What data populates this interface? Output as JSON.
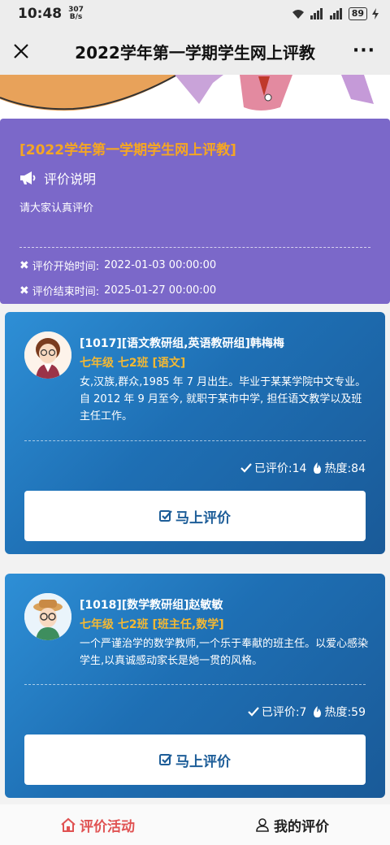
{
  "status_bar": {
    "time": "10:48",
    "speed_value": "307",
    "speed_unit": "B/s",
    "battery": "89"
  },
  "nav": {
    "title": "2022学年第一学期学生网上评教"
  },
  "info": {
    "title": "[2022学年第一学期学生网上评教]",
    "heading": "评价说明",
    "description": "请大家认真评价",
    "start_label": "评价开始时间:",
    "start_time": "2022-01-03 00:00:00",
    "end_label": "评价结束时间:",
    "end_time": "2025-01-27 00:00:00"
  },
  "teachers": [
    {
      "name": "[1017][语文教研组,英语教研组]韩梅梅",
      "class": "七年级 七2班 [语文]",
      "description": "女,汉族,群众,1985 年 7 月出生。毕业于某某学院中文专业。自 2012 年 9 月至今, 就职于某市中学, 担任语文教学以及班主任工作。",
      "rated": "已评价:14",
      "heat": "热度:84",
      "button": "马上评价"
    },
    {
      "name": "[1018][数学教研组]赵敏敏",
      "class": "七年级 七2班 [班主任,数学]",
      "description": "一个严谨治学的数学教师,一个乐于奉献的班主任。以爱心感染学生,以真诚感动家长是她一贯的风格。",
      "rated": "已评价:7",
      "heat": "热度:59",
      "button": "马上评价"
    }
  ],
  "tabs": {
    "activity": "评价活动",
    "mine": "我的评价"
  },
  "colors": {
    "accent_orange": "#f5a623",
    "info_bg": "#7b68c9",
    "card_blue": "#1e6fb4",
    "tab_active": "#e05252"
  }
}
